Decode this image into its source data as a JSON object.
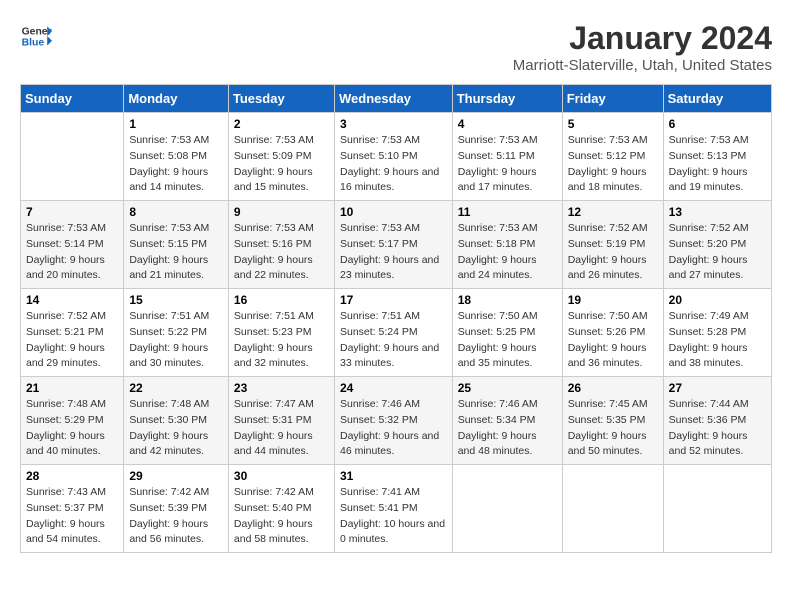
{
  "header": {
    "logo_line1": "General",
    "logo_line2": "Blue",
    "title": "January 2024",
    "subtitle": "Marriott-Slaterville, Utah, United States"
  },
  "days_of_week": [
    "Sunday",
    "Monday",
    "Tuesday",
    "Wednesday",
    "Thursday",
    "Friday",
    "Saturday"
  ],
  "weeks": [
    [
      {
        "day": "",
        "sunrise": "",
        "sunset": "",
        "daylight": ""
      },
      {
        "day": "1",
        "sunrise": "7:53 AM",
        "sunset": "5:08 PM",
        "daylight": "9 hours and 14 minutes."
      },
      {
        "day": "2",
        "sunrise": "7:53 AM",
        "sunset": "5:09 PM",
        "daylight": "9 hours and 15 minutes."
      },
      {
        "day": "3",
        "sunrise": "7:53 AM",
        "sunset": "5:10 PM",
        "daylight": "9 hours and 16 minutes."
      },
      {
        "day": "4",
        "sunrise": "7:53 AM",
        "sunset": "5:11 PM",
        "daylight": "9 hours and 17 minutes."
      },
      {
        "day": "5",
        "sunrise": "7:53 AM",
        "sunset": "5:12 PM",
        "daylight": "9 hours and 18 minutes."
      },
      {
        "day": "6",
        "sunrise": "7:53 AM",
        "sunset": "5:13 PM",
        "daylight": "9 hours and 19 minutes."
      }
    ],
    [
      {
        "day": "7",
        "sunrise": "7:53 AM",
        "sunset": "5:14 PM",
        "daylight": "9 hours and 20 minutes."
      },
      {
        "day": "8",
        "sunrise": "7:53 AM",
        "sunset": "5:15 PM",
        "daylight": "9 hours and 21 minutes."
      },
      {
        "day": "9",
        "sunrise": "7:53 AM",
        "sunset": "5:16 PM",
        "daylight": "9 hours and 22 minutes."
      },
      {
        "day": "10",
        "sunrise": "7:53 AM",
        "sunset": "5:17 PM",
        "daylight": "9 hours and 23 minutes."
      },
      {
        "day": "11",
        "sunrise": "7:53 AM",
        "sunset": "5:18 PM",
        "daylight": "9 hours and 24 minutes."
      },
      {
        "day": "12",
        "sunrise": "7:52 AM",
        "sunset": "5:19 PM",
        "daylight": "9 hours and 26 minutes."
      },
      {
        "day": "13",
        "sunrise": "7:52 AM",
        "sunset": "5:20 PM",
        "daylight": "9 hours and 27 minutes."
      }
    ],
    [
      {
        "day": "14",
        "sunrise": "7:52 AM",
        "sunset": "5:21 PM",
        "daylight": "9 hours and 29 minutes."
      },
      {
        "day": "15",
        "sunrise": "7:51 AM",
        "sunset": "5:22 PM",
        "daylight": "9 hours and 30 minutes."
      },
      {
        "day": "16",
        "sunrise": "7:51 AM",
        "sunset": "5:23 PM",
        "daylight": "9 hours and 32 minutes."
      },
      {
        "day": "17",
        "sunrise": "7:51 AM",
        "sunset": "5:24 PM",
        "daylight": "9 hours and 33 minutes."
      },
      {
        "day": "18",
        "sunrise": "7:50 AM",
        "sunset": "5:25 PM",
        "daylight": "9 hours and 35 minutes."
      },
      {
        "day": "19",
        "sunrise": "7:50 AM",
        "sunset": "5:26 PM",
        "daylight": "9 hours and 36 minutes."
      },
      {
        "day": "20",
        "sunrise": "7:49 AM",
        "sunset": "5:28 PM",
        "daylight": "9 hours and 38 minutes."
      }
    ],
    [
      {
        "day": "21",
        "sunrise": "7:48 AM",
        "sunset": "5:29 PM",
        "daylight": "9 hours and 40 minutes."
      },
      {
        "day": "22",
        "sunrise": "7:48 AM",
        "sunset": "5:30 PM",
        "daylight": "9 hours and 42 minutes."
      },
      {
        "day": "23",
        "sunrise": "7:47 AM",
        "sunset": "5:31 PM",
        "daylight": "9 hours and 44 minutes."
      },
      {
        "day": "24",
        "sunrise": "7:46 AM",
        "sunset": "5:32 PM",
        "daylight": "9 hours and 46 minutes."
      },
      {
        "day": "25",
        "sunrise": "7:46 AM",
        "sunset": "5:34 PM",
        "daylight": "9 hours and 48 minutes."
      },
      {
        "day": "26",
        "sunrise": "7:45 AM",
        "sunset": "5:35 PM",
        "daylight": "9 hours and 50 minutes."
      },
      {
        "day": "27",
        "sunrise": "7:44 AM",
        "sunset": "5:36 PM",
        "daylight": "9 hours and 52 minutes."
      }
    ],
    [
      {
        "day": "28",
        "sunrise": "7:43 AM",
        "sunset": "5:37 PM",
        "daylight": "9 hours and 54 minutes."
      },
      {
        "day": "29",
        "sunrise": "7:42 AM",
        "sunset": "5:39 PM",
        "daylight": "9 hours and 56 minutes."
      },
      {
        "day": "30",
        "sunrise": "7:42 AM",
        "sunset": "5:40 PM",
        "daylight": "9 hours and 58 minutes."
      },
      {
        "day": "31",
        "sunrise": "7:41 AM",
        "sunset": "5:41 PM",
        "daylight": "10 hours and 0 minutes."
      },
      {
        "day": "",
        "sunrise": "",
        "sunset": "",
        "daylight": ""
      },
      {
        "day": "",
        "sunrise": "",
        "sunset": "",
        "daylight": ""
      },
      {
        "day": "",
        "sunrise": "",
        "sunset": "",
        "daylight": ""
      }
    ]
  ]
}
